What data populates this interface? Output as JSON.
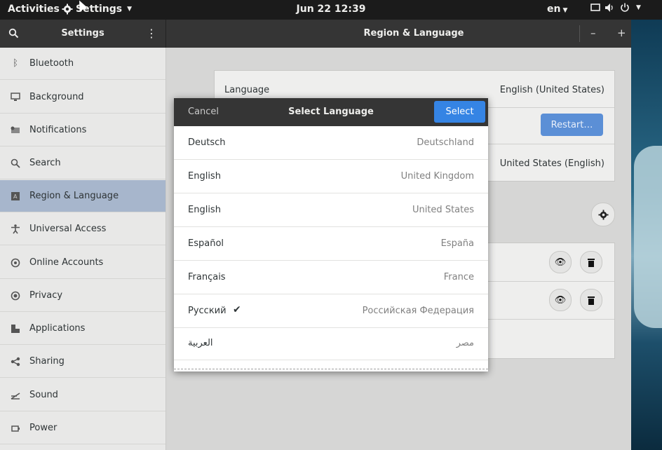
{
  "topbar": {
    "activities": "Activities",
    "app_menu": "Settings",
    "clock": "Jun 22  12:39",
    "input_lang": "en"
  },
  "header": {
    "sidebar_title": "Settings",
    "main_title": "Region & Language"
  },
  "sidebar": {
    "items": [
      {
        "label": "Bluetooth",
        "icon": "bluetooth-icon"
      },
      {
        "label": "Background",
        "icon": "monitor-icon"
      },
      {
        "label": "Notifications",
        "icon": "notifications-icon"
      },
      {
        "label": "Search",
        "icon": "search-icon"
      },
      {
        "label": "Region & Language",
        "icon": "region-language-icon",
        "active": true
      },
      {
        "label": "Universal Access",
        "icon": "accessibility-icon"
      },
      {
        "label": "Online Accounts",
        "icon": "online-accounts-icon"
      },
      {
        "label": "Privacy",
        "icon": "privacy-icon"
      },
      {
        "label": "Applications",
        "icon": "applications-icon"
      },
      {
        "label": "Sharing",
        "icon": "share-icon"
      },
      {
        "label": "Sound",
        "icon": "sound-icon"
      },
      {
        "label": "Power",
        "icon": "power-icon"
      }
    ]
  },
  "main": {
    "language_label": "Language",
    "language_value": "English (United States)",
    "restart_label": "Restart…",
    "formats_value": "United States (English)"
  },
  "dialog": {
    "cancel": "Cancel",
    "title": "Select Language",
    "select": "Select",
    "languages": [
      {
        "name": "Deutsch",
        "region": "Deutschland"
      },
      {
        "name": "English",
        "region": "United Kingdom"
      },
      {
        "name": "English",
        "region": "United States"
      },
      {
        "name": "Español",
        "region": "España"
      },
      {
        "name": "Français",
        "region": "France"
      },
      {
        "name": "Русский",
        "region": "Российская Федерация",
        "checked": true
      },
      {
        "name": "العربية",
        "region": "مصر"
      }
    ]
  },
  "colors": {
    "accent": "#3584e4",
    "sidebar_active": "#a7b6cc",
    "headerbar": "#353535"
  }
}
